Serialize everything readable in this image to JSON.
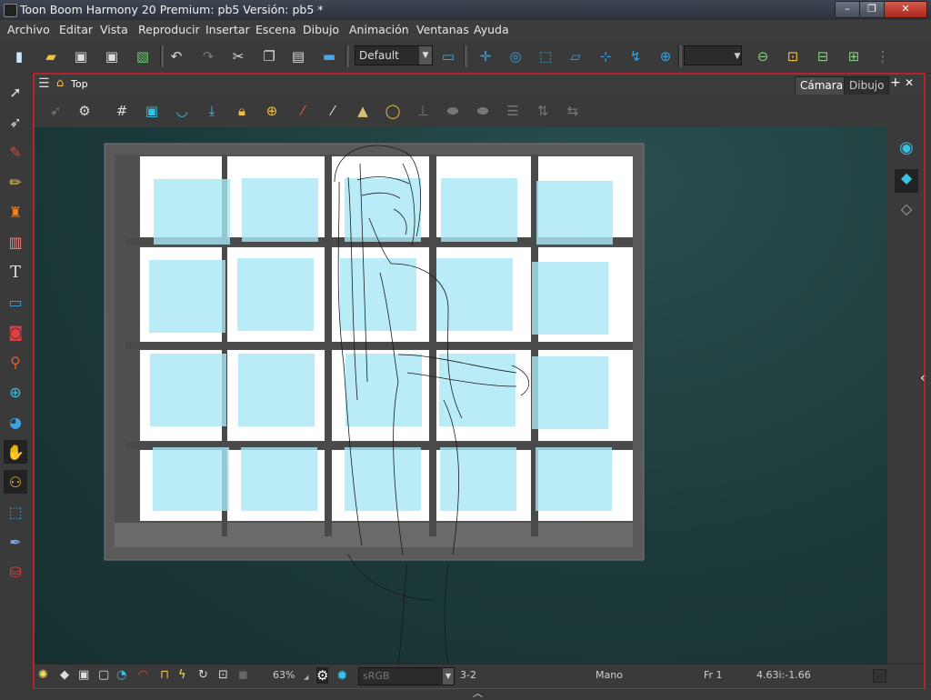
{
  "window": {
    "title": "Toon Boom Harmony 20 Premium: pb5 Versión: pb5 *",
    "controls": {
      "minimize": "–",
      "maximize": "❐",
      "close": "✕"
    }
  },
  "menu": [
    "Archivo",
    "Editar",
    "Vista",
    "Reproducir",
    "Insertar",
    "Escena",
    "Dibujo",
    "Animación",
    "Ventanas",
    "Ayuda"
  ],
  "toolbar": {
    "preset_value": "Default",
    "icons": [
      "new-scene-icon",
      "open-icon",
      "save-icon",
      "save-as-icon",
      "import-icon",
      "undo-icon",
      "redo-icon",
      "cut-icon",
      "copy-icon",
      "paste-icon",
      "scene-settings-icon",
      "workspace-icon",
      "transform-icon",
      "rotate-icon",
      "scale-icon",
      "skew-icon",
      "maintain-size-icon",
      "reset-icon",
      "layer-icon",
      "onion-skin-icon",
      "peg-icon",
      "add-layer-icon"
    ]
  },
  "view": {
    "breadcrumb": "Top",
    "tabs": [
      "Cámara",
      "Dibujo"
    ],
    "active_tab": "Cámara",
    "add_view": "+",
    "close_view": "✕"
  },
  "statusbar": {
    "zoom": "63%",
    "color_space": "sRGB",
    "frame_range": "3-2",
    "tool": "Mano",
    "frame": "Fr 1",
    "coords": "4.63i:-1.66"
  },
  "colors": {
    "accent_red": "#b8222a",
    "canvas_bg": "#1d3a3a",
    "window_pane": "#bff0fa",
    "frame_gray": "#555555"
  }
}
